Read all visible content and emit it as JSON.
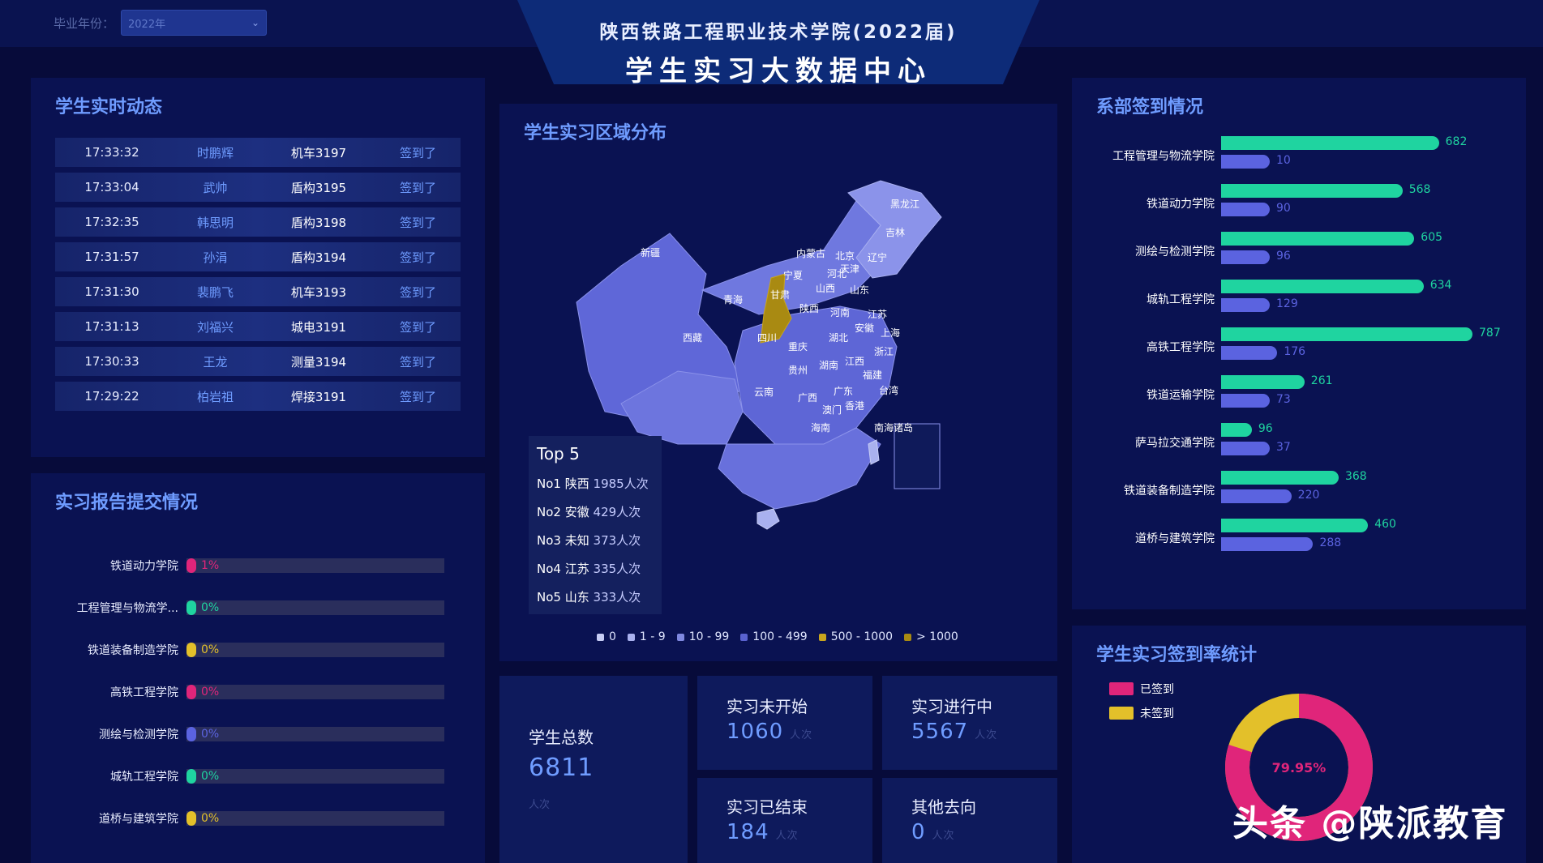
{
  "header": {
    "filter_label": "毕业年份：",
    "filter_value": "2022年",
    "title_line1": "陕西铁路工程职业技术学院(2022届)",
    "title_line2": "学生实习大数据中心"
  },
  "realtime": {
    "title": "学生实时动态",
    "rows": [
      {
        "time": "17:33:32",
        "name": "时鹏辉",
        "train": "机车3197",
        "status": "签到了"
      },
      {
        "time": "17:33:04",
        "name": "武帅",
        "train": "盾构3195",
        "status": "签到了"
      },
      {
        "time": "17:32:35",
        "name": "韩思明",
        "train": "盾构3198",
        "status": "签到了"
      },
      {
        "time": "17:31:57",
        "name": "孙涓",
        "train": "盾构3194",
        "status": "签到了"
      },
      {
        "time": "17:31:30",
        "name": "裴鹏飞",
        "train": "机车3193",
        "status": "签到了"
      },
      {
        "time": "17:31:13",
        "name": "刘福兴",
        "train": "城电3191",
        "status": "签到了"
      },
      {
        "time": "17:30:33",
        "name": "王龙",
        "train": "测量3194",
        "status": "签到了"
      },
      {
        "time": "17:29:22",
        "name": "柏岩祖",
        "train": "焊接3191",
        "status": "签到了"
      }
    ]
  },
  "report": {
    "title": "实习报告提交情况",
    "rows": [
      {
        "label": "铁道动力学院",
        "pct": "1%",
        "color": "#e0257a"
      },
      {
        "label": "工程管理与物流学...",
        "pct": "0%",
        "color": "#1fd4a0"
      },
      {
        "label": "铁道装备制造学院",
        "pct": "0%",
        "color": "#e3c02a"
      },
      {
        "label": "高铁工程学院",
        "pct": "0%",
        "color": "#e0257a"
      },
      {
        "label": "测绘与检测学院",
        "pct": "0%",
        "color": "#5b63e0"
      },
      {
        "label": "城轨工程学院",
        "pct": "0%",
        "color": "#1fd4a0"
      },
      {
        "label": "道桥与建筑学院",
        "pct": "0%",
        "color": "#e3c02a"
      }
    ]
  },
  "map": {
    "title": "学生实习区域分布",
    "provinces": [
      "黑龙江",
      "吉林",
      "辽宁",
      "内蒙古",
      "北京",
      "天津",
      "河北",
      "宁夏",
      "山西",
      "山东",
      "新疆",
      "青海",
      "甘肃",
      "陕西",
      "河南",
      "江苏",
      "安徽",
      "上海",
      "西藏",
      "四川",
      "湖北",
      "重庆",
      "浙江",
      "江西",
      "湖南",
      "贵州",
      "福建",
      "云南",
      "广西",
      "广东",
      "台湾",
      "澳门",
      "香港",
      "海南",
      "南海诸岛"
    ],
    "top5_title": "Top 5",
    "top5": [
      {
        "rank": "No1",
        "name": "陕西",
        "value": "1985人次"
      },
      {
        "rank": "No2",
        "name": "安徽",
        "value": "429人次"
      },
      {
        "rank": "No3",
        "name": "未知",
        "value": "373人次"
      },
      {
        "rank": "No4",
        "name": "江苏",
        "value": "335人次"
      },
      {
        "rank": "No5",
        "name": "山东",
        "value": "333人次"
      }
    ],
    "legend": [
      {
        "label": "0",
        "color": "#c7cdf5"
      },
      {
        "label": "1 - 9",
        "color": "#a9b1ef"
      },
      {
        "label": "10 - 99",
        "color": "#7f88e0"
      },
      {
        "label": "100 - 499",
        "color": "#5a62cf"
      },
      {
        "label": "500 - 1000",
        "color": "#c9a51e"
      },
      {
        "label": "> 1000",
        "color": "#a98a12"
      }
    ]
  },
  "stats": {
    "total_label": "学生总数",
    "total_value": "6811",
    "total_unit": "人次",
    "not_started_label": "实习未开始",
    "not_started_value": "1060",
    "in_progress_label": "实习进行中",
    "in_progress_value": "5567",
    "ended_label": "实习已结束",
    "ended_value": "184",
    "other_label": "其他去向",
    "other_value": "0",
    "unit": "人次"
  },
  "dept_signin": {
    "title": "系部签到情况",
    "colors": {
      "signed": "#1fd4a0",
      "unsigned": "#5b63e0"
    },
    "rows": [
      {
        "label": "工程管理与物流学院",
        "signed": 682,
        "unsigned": 10
      },
      {
        "label": "铁道动力学院",
        "signed": 568,
        "unsigned": 90
      },
      {
        "label": "测绘与检测学院",
        "signed": 605,
        "unsigned": 96
      },
      {
        "label": "城轨工程学院",
        "signed": 634,
        "unsigned": 129
      },
      {
        "label": "高铁工程学院",
        "signed": 787,
        "unsigned": 176
      },
      {
        "label": "铁道运输学院",
        "signed": 261,
        "unsigned": 73
      },
      {
        "label": "萨马拉交通学院",
        "signed": 96,
        "unsigned": 37
      },
      {
        "label": "铁道装备制造学院",
        "signed": 368,
        "unsigned": 220
      },
      {
        "label": "道桥与建筑学院",
        "signed": 460,
        "unsigned": 288
      }
    ]
  },
  "signrate": {
    "title": "学生实习签到率统计",
    "legend_signed": "已签到",
    "legend_unsigned": "未签到",
    "signed_color": "#e0257a",
    "unsigned_color": "#e3c02a",
    "signed_pct": 79.95,
    "center_label": "79.95%"
  },
  "watermark": "头条 @陕派教育",
  "chart_data": [
    {
      "type": "bar",
      "title": "系部签到情况",
      "categories": [
        "工程管理与物流学院",
        "铁道动力学院",
        "测绘与检测学院",
        "城轨工程学院",
        "高铁工程学院",
        "铁道运输学院",
        "萨马拉交通学院",
        "铁道装备制造学院",
        "道桥与建筑学院"
      ],
      "series": [
        {
          "values": [
            682,
            568,
            605,
            634,
            787,
            261,
            96,
            368,
            460
          ]
        },
        {
          "values": [
            10,
            90,
            96,
            129,
            176,
            73,
            37,
            220,
            288
          ]
        }
      ]
    },
    {
      "type": "pie",
      "title": "学生实习签到率统计",
      "labels": [
        "已签到",
        "未签到"
      ],
      "values": [
        79.95,
        20.05
      ]
    }
  ]
}
